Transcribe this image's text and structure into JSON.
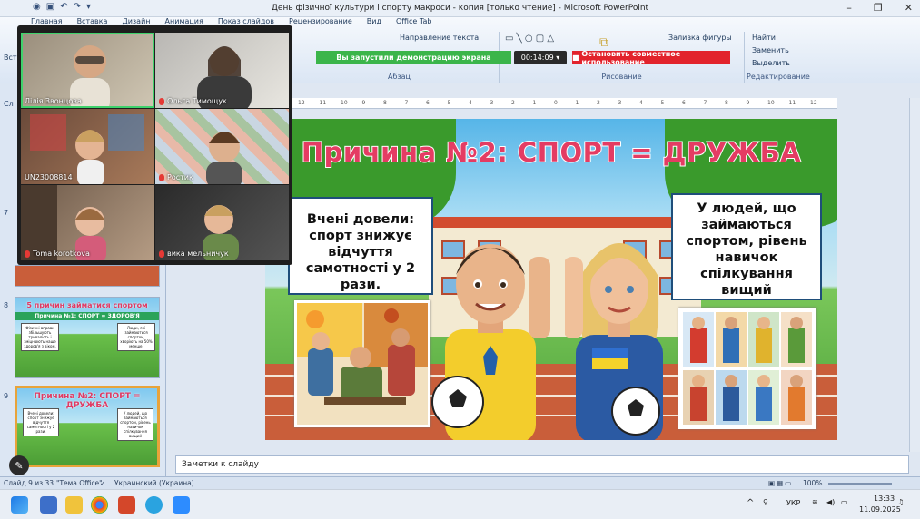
{
  "window": {
    "title": "День фізичної культури і спорту макроси - копия [только чтение] - Microsoft PowerPoint"
  },
  "ribbon": {
    "tabs": [
      "Главная",
      "Вставка",
      "Дизайн",
      "Анимация",
      "Показ слайдов",
      "Рецензирование",
      "Вид",
      "Office Tab"
    ],
    "paste_label": "Вста",
    "paragraph_group": "Абзац",
    "text_direction": "Направление текста",
    "drawing_group": "Рисование",
    "fill_label": "Заливка фигуры",
    "editing_group": "Редактирование",
    "find": "Найти",
    "replace": "Заменить",
    "select": "Выделить"
  },
  "sharebar": {
    "status": "Вы запустили демонстрацию экрана",
    "timer": "00:14:09",
    "stop": "Остановить совместное использование"
  },
  "video": {
    "participants": [
      {
        "name": "Лілія Звонцова",
        "muted": false,
        "active": true
      },
      {
        "name": "Ольга Тимощук",
        "muted": true,
        "active": false
      },
      {
        "name": "UN23008814",
        "muted": false,
        "active": false
      },
      {
        "name": "Ростик",
        "muted": true,
        "active": false
      },
      {
        "name": "Toma korotkova",
        "muted": true,
        "active": false
      },
      {
        "name": "вика мельничук",
        "muted": true,
        "active": false
      }
    ]
  },
  "left_pane": {
    "tab": "Сл",
    "thumbs": [
      {
        "num": "7",
        "title": "",
        "subtitle": ""
      },
      {
        "num": "8",
        "title": "5 причин займатися спортом",
        "subtitle": "Причина №1: СПОРТ = ЗДОРОВ'Я",
        "card_left": "Фізичні вправи збільшують тривалість і зміцнюють наше здоров'я з віком.",
        "card_right": "Люди, які займаються спортом, хворіють на 50% менше."
      },
      {
        "num": "9",
        "title": "Причина №2: СПОРТ = ДРУЖБА",
        "subtitle": "",
        "card_left": "Вчені довели: спорт знижує відчуття самотності у 2 рази.",
        "card_right": "У людей, що займаються спортом, рівень навичок спілкування вищий"
      }
    ]
  },
  "slide": {
    "title": "Причина №2: СПОРТ = ДРУЖБА",
    "left_text": "Вчені довели: спорт знижує відчуття самотності у 2 рази.",
    "right_text": "У людей, що займаються спортом, рівень навичок спілкування вищий"
  },
  "ruler": {
    "ticks": [
      "12",
      "11",
      "10",
      "9",
      "8",
      "7",
      "6",
      "5",
      "4",
      "3",
      "2",
      "1",
      "0",
      "1",
      "2",
      "3",
      "4",
      "5",
      "6",
      "7",
      "8",
      "9",
      "10",
      "11",
      "12"
    ]
  },
  "notes": {
    "placeholder": "Заметки к слайду"
  },
  "status": {
    "slide": "Слайд 9 из 33",
    "theme": "\"Тема Office\"",
    "language": "Украинский (Украина)",
    "zoom": "100%"
  },
  "taskbar": {
    "lang": "УКР",
    "time": "13:33",
    "date": "11.09.2025"
  },
  "colors": {
    "accent_title": "#e43c63",
    "share_green": "#3bb54a",
    "stop_red": "#e2232c"
  }
}
